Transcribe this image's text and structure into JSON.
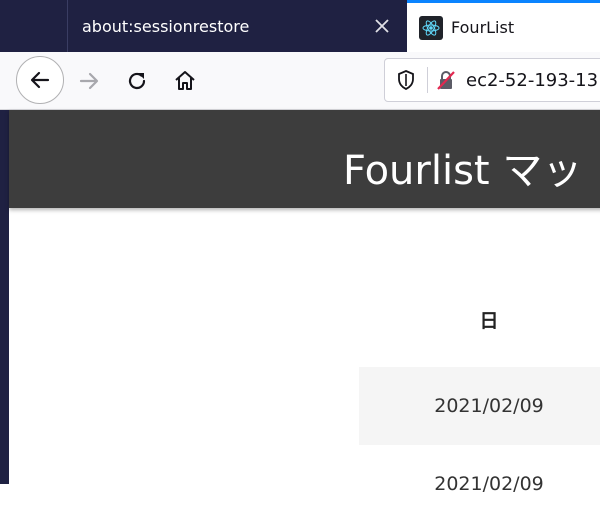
{
  "tabs": [
    {
      "title": "about:sessionrestore",
      "active": false
    },
    {
      "title": "FourList",
      "active": true
    }
  ],
  "urlbar": {
    "url": "ec2-52-193-13"
  },
  "app": {
    "title": "Fourlist マッ"
  },
  "table": {
    "column_header": "日",
    "rows": [
      "2021/02/09",
      "2021/02/09"
    ]
  },
  "colors": {
    "tabstrip": "#1f2142",
    "tab_accent": "#0a84ff",
    "app_header": "#3d3d3d",
    "row_alt": "#f5f5f5"
  }
}
